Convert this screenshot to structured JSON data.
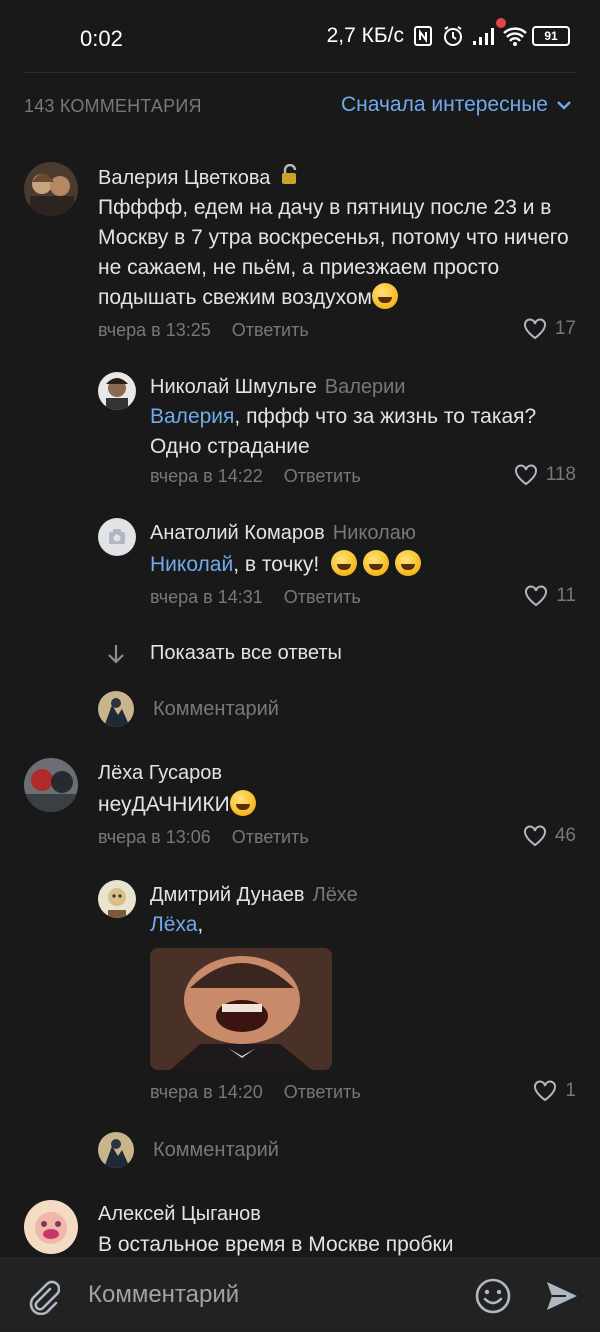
{
  "status_bar": {
    "time": "0:02",
    "network_speed": "2,7 КБ/с",
    "battery": "91",
    "icons": [
      "nfc-icon",
      "alarm-icon",
      "signal-icon",
      "wifi-icon",
      "battery-icon"
    ]
  },
  "header": {
    "count": "143 КОММЕНТАРИЯ",
    "sort_label": "Сначала интересные"
  },
  "comments": [
    {
      "author": "Валерия Цветкова",
      "badge": "lock-icon",
      "text": "Пфффф, едем на дачу в пятницу после 23 и в Москву в 7 утра воскресенья, потому что ничего не сажаем, не пьём, а приезжаем просто подышать свежим воздухом",
      "time": "вчера в 13:25",
      "reply": "Ответить",
      "likes": "17"
    },
    {
      "author": "Николай Шмульге",
      "reply_to": "Валерии",
      "mention": "Валерия",
      "text": ", пффф что за жизнь то такая? Одно страдание",
      "time": "вчера в 14:22",
      "reply": "Ответить",
      "likes": "118"
    },
    {
      "author": "Анатолий Комаров",
      "reply_to": "Николаю",
      "mention": "Николай",
      "text": ", в точку!",
      "time": "вчера в 14:31",
      "reply": "Ответить",
      "likes": "11"
    },
    {
      "author": "Лёха Гусаров",
      "text": "неуДАЧНИКИ",
      "time": "вчера в 13:06",
      "reply": "Ответить",
      "likes": "46"
    },
    {
      "author": "Дмитрий Дунаев",
      "reply_to": "Лёхе",
      "mention": "Лёха",
      "text": ",",
      "time": "вчера в 14:20",
      "reply": "Ответить",
      "likes": "1"
    },
    {
      "author": "Алексей Цыганов",
      "text": "В остальное время в Москве пробки"
    }
  ],
  "show_all_replies": "Показать все ответы",
  "comment_placeholder": "Комментарий",
  "bottom_bar": {
    "placeholder": "Комментарий"
  },
  "colors": {
    "background": "#191919",
    "accent": "#71aaeb",
    "secondary_text": "#76787a",
    "primary_text": "#e1e3e6"
  }
}
